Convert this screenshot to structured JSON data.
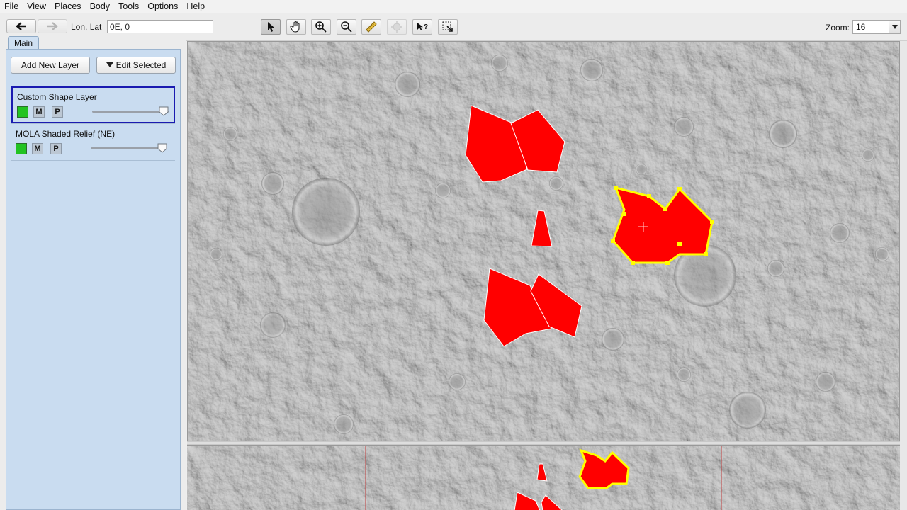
{
  "menu": [
    "File",
    "View",
    "Places",
    "Body",
    "Tools",
    "Options",
    "Help"
  ],
  "toolbar": {
    "back_icon": "arrow-left-icon",
    "forward_icon": "arrow-right-icon",
    "lonlat_label": "Lon, Lat",
    "lonlat_value": "0E, 0",
    "tools": [
      "select-arrow-icon",
      "pan-hand-icon",
      "zoom-in-icon",
      "zoom-out-icon",
      "ruler-icon",
      "disabled-tool-icon",
      "investigate-icon",
      "export-icon"
    ],
    "zoom_label": "Zoom:",
    "zoom_value": "16"
  },
  "sidebar": {
    "tab_label": "Main",
    "add_layer_label": "Add New Layer",
    "edit_selected_label": "Edit Selected",
    "layers": [
      {
        "name": "Custom Shape Layer",
        "m": "M",
        "p": "P",
        "color": "#22c322",
        "opacity": 1.0,
        "selected": true
      },
      {
        "name": "MOLA Shaded Relief (NE)",
        "m": "M",
        "p": "P",
        "color": "#22c322",
        "opacity": 1.0,
        "selected": false
      }
    ]
  },
  "colors": {
    "shape_fill": "#ff0000",
    "selection": "#ffff00",
    "panel_bg": "#c9dcf0",
    "selected_border": "#1a1ab0",
    "terrain": "#9c9c9c"
  }
}
